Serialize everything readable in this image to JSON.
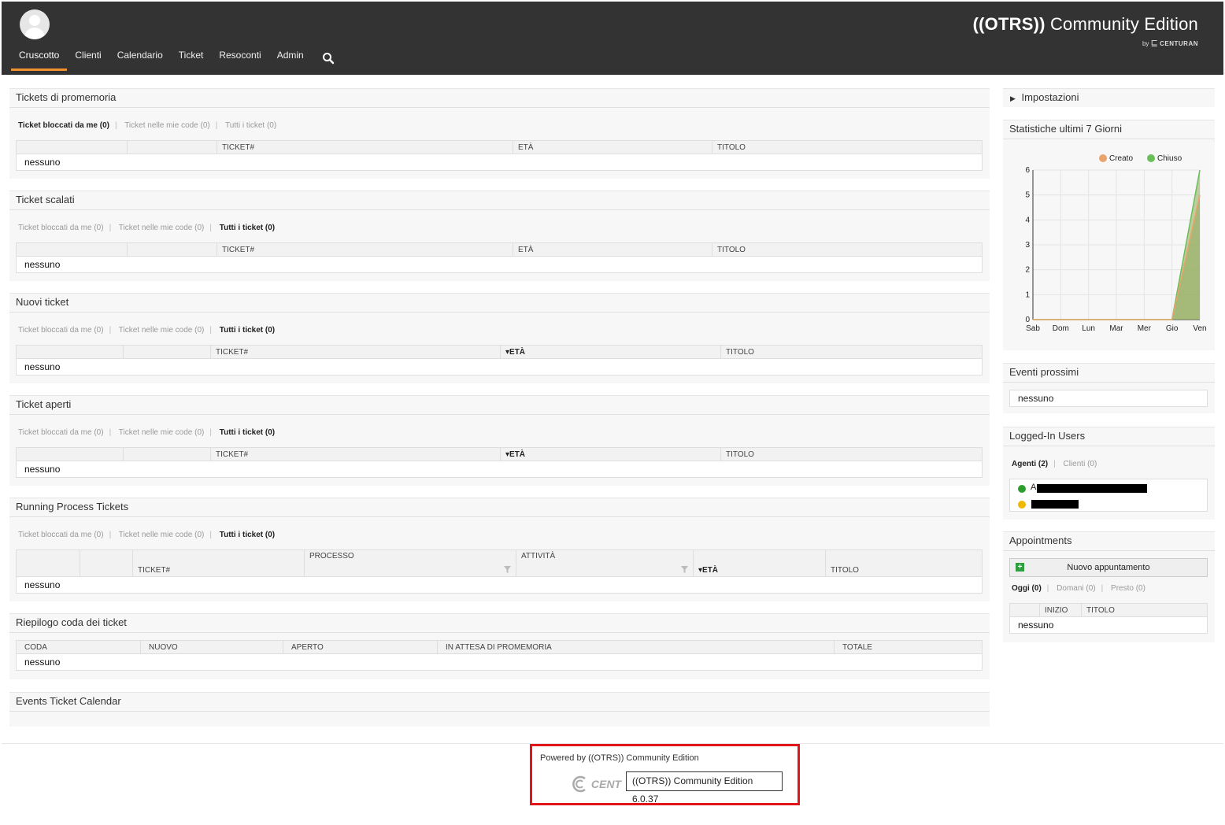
{
  "header": {
    "nav": [
      "Cruscotto",
      "Clienti",
      "Calendario",
      "Ticket",
      "Resoconti",
      "Admin"
    ],
    "active_nav": "Cruscotto",
    "brand_open": "((OTRS))",
    "brand_rest": " Community Edition",
    "brand_by": "by",
    "brand_company": "CENTURAN"
  },
  "widgets": {
    "promemoria": {
      "title": "Tickets di promemoria",
      "filters": [
        "Ticket bloccati da me (0)",
        "Ticket nelle mie code (0)",
        "Tutti i ticket (0)"
      ],
      "columns": [
        "",
        "",
        "TICKET#",
        "ETÀ",
        "TITOLO"
      ],
      "empty": "nessuno"
    },
    "scalati": {
      "title": "Ticket scalati",
      "filters": [
        "Ticket bloccati da me (0)",
        "Ticket nelle mie code (0)",
        "Tutti i ticket (0)"
      ],
      "columns": [
        "",
        "",
        "TICKET#",
        "ETÀ",
        "TITOLO"
      ],
      "empty": "nessuno"
    },
    "nuovi": {
      "title": "Nuovi ticket",
      "filters": [
        "Ticket bloccati da me (0)",
        "Ticket nelle mie code (0)",
        "Tutti i ticket (0)"
      ],
      "columns": [
        "",
        "",
        "TICKET#",
        "▾ETÀ",
        "TITOLO"
      ],
      "empty": "nessuno"
    },
    "aperti": {
      "title": "Ticket aperti",
      "filters": [
        "Ticket bloccati da me (0)",
        "Ticket nelle mie code (0)",
        "Tutti i ticket (0)"
      ],
      "columns": [
        "",
        "",
        "TICKET#",
        "▾ETÀ",
        "TITOLO"
      ],
      "empty": "nessuno"
    },
    "process": {
      "title": "Running Process Tickets",
      "filters": [
        "Ticket bloccati da me (0)",
        "Ticket nelle mie code (0)",
        "Tutti i ticket (0)"
      ],
      "columns": [
        "",
        "",
        "TICKET#",
        "PROCESSO",
        "ATTIVITÀ",
        "▾ETÀ",
        "TITOLO"
      ],
      "empty": "nessuno"
    },
    "coda": {
      "title": "Riepilogo coda dei ticket",
      "columns": [
        "CODA",
        "NUOVO",
        "APERTO",
        "IN ATTESA DI PROMEMORIA",
        "TOTALE"
      ],
      "empty": "nessuno"
    },
    "calendar": {
      "title": "Events Ticket Calendar"
    }
  },
  "sidebar": {
    "settings": "Impostazioni",
    "stats_title": "Statistiche ultimi 7 Giorni",
    "events_title": "Eventi prossimi",
    "events_empty": "nessuno",
    "users_title": "Logged-In Users",
    "users_filters": [
      "Agenti (2)",
      "Clienti (0)"
    ],
    "users_first_letter": "A",
    "appointments_title": "Appointments",
    "new_appointment": "Nuovo appuntamento",
    "appointment_filters": [
      "Oggi (0)",
      "Domani (0)",
      "Presto (0)"
    ],
    "appointment_columns": [
      "",
      "INIZIO",
      "TITOLO"
    ],
    "appointment_empty": "nessuno"
  },
  "chart_data": {
    "type": "area",
    "title": "",
    "categories": [
      "Sab",
      "Dom",
      "Lun",
      "Mar",
      "Mer",
      "Gio",
      "Ven"
    ],
    "ylim": [
      0,
      6
    ],
    "yticks": [
      0,
      1,
      2,
      3,
      4,
      5,
      6
    ],
    "grid": true,
    "legend_position": "top-right",
    "series": [
      {
        "name": "Creato",
        "color": "#e8a46a",
        "values": [
          0,
          0,
          0,
          0,
          0,
          0,
          5
        ]
      },
      {
        "name": "Chiuso",
        "color": "#6bbf59",
        "values": [
          0,
          0,
          0,
          0,
          0,
          0,
          6
        ]
      }
    ]
  },
  "footer": {
    "powered": "Powered by ((OTRS)) Community Edition",
    "cent_partial": "CENT",
    "tooltip": "((OTRS)) Community Edition 6.0.37"
  },
  "colors": {
    "header_bg": "#333333",
    "accent": "#f0932e",
    "highlight_border": "#e3151a"
  }
}
